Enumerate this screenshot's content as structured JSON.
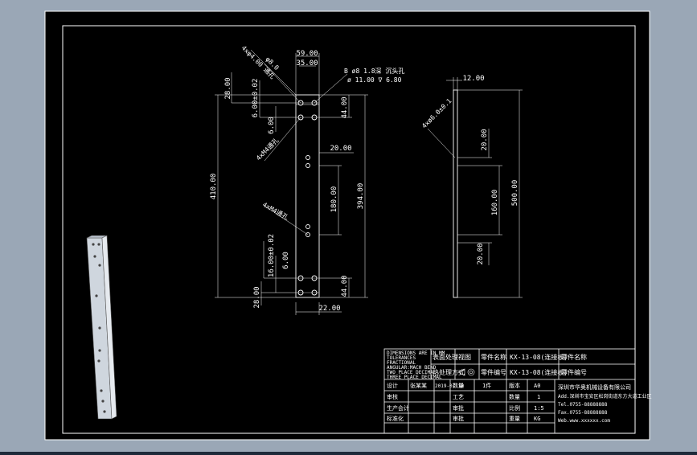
{
  "colors": {
    "viewport_bg": "#9aa7b6",
    "sheet_bg": "#000000",
    "line": "#ffffff",
    "dim": "#e8e8e8",
    "iso_bg": "#d9e0e8"
  },
  "front_view": {
    "dims": {
      "top_width": "59.00",
      "inner_width": "35.00",
      "left_28": "28.00",
      "six_02": "6.00±0.02",
      "six": "6.00",
      "total_410": "410.00",
      "hole_pitch_44_top": "44.00",
      "offset_20": "20.00",
      "span_180": "180.00",
      "span_394": "394.00",
      "sixteen_02": "16.00±0.02",
      "six_bottom": "6.00",
      "bottom_28": "28.00",
      "pitch_44_bottom": "44.00",
      "bottom_22": "22.00"
    },
    "callouts": {
      "top_holes": "4xφ4.00 通孔",
      "top_hole_note": "φ8.0",
      "thread_top": "4xM4通孔",
      "thread_mid": "4xM4通孔",
      "boss_1": "B ø8 1.8深 沉头孔",
      "boss_2": "ø 11.00 ∇ 6.80"
    }
  },
  "side_view": {
    "dims": {
      "thickness": "12.00",
      "hole_note": "4xø6.0±0.1",
      "offset_20_top": "20.00",
      "span_160": "160.00",
      "total_500": "500.00",
      "offset_20_bottom": "20.00"
    }
  },
  "title_block": {
    "notes": [
      "DIMENSIONS ARE IN MM",
      "TOLERANCES",
      "FRACTIONAL",
      "ANGULAR:MACH BEND",
      "TWO PLACE DECIMAL",
      "THREE PLACE DECIMAL"
    ],
    "row1": {
      "c1": "表面处理",
      "c2": "视图",
      "c3": "零件名称",
      "c4": "KX-13-08(连接板)",
      "c5": "零件名称"
    },
    "row2": {
      "c1": "热处理方式",
      "c3": "零件编号",
      "c4": "KX-13-08(连接板)",
      "c5": "零件编号"
    },
    "rows": [
      {
        "a": "设计",
        "b": "张某某",
        "c": "2019-07-10",
        "d": "数量",
        "e": "1件",
        "f": "版本",
        "g": "A0"
      },
      {
        "a": "审核",
        "b": "",
        "c": "",
        "d": "工艺",
        "e": "",
        "f": "数量",
        "g": "1"
      },
      {
        "a": "生产会计",
        "b": "",
        "c": "",
        "d": "审批",
        "e": "",
        "f": "比例",
        "g": "1:5"
      },
      {
        "a": "标准化",
        "b": "",
        "c": "",
        "d": "审批",
        "e": "",
        "f": "重量",
        "g": "KG"
      }
    ],
    "company": {
      "name": "深圳市华奥机械设备有限公司",
      "addr": "Add.深圳市宝安区松岗街道东方大道工业区",
      "tel": "Tel.0755-88888888",
      "fax": "Fax.0755-88888888",
      "web": "Web.www.xxxxxx.com"
    }
  }
}
